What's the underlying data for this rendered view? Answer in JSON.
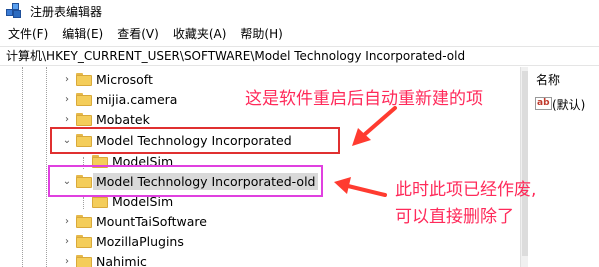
{
  "window": {
    "title": "注册表编辑器"
  },
  "menubar": {
    "items": [
      "文件(F)",
      "编辑(E)",
      "查看(V)",
      "收藏夹(A)",
      "帮助(H)"
    ]
  },
  "address": {
    "path": "计算机\\HKEY_CURRENT_USER\\SOFTWARE\\Model Technology Incorporated-old"
  },
  "tree": {
    "items": [
      {
        "label": "Microsoft",
        "expander": "›"
      },
      {
        "label": "mijia.camera",
        "expander": "›"
      },
      {
        "label": "Mobatek",
        "expander": "›"
      },
      {
        "label": "Model Technology Incorporated",
        "expander": "⌄"
      },
      {
        "label": "ModelSim",
        "expander": ""
      },
      {
        "label": "Model Technology Incorporated-old",
        "expander": "⌄"
      },
      {
        "label": "ModelSim",
        "expander": ""
      },
      {
        "label": "MountTaiSoftware",
        "expander": "›"
      },
      {
        "label": "MozillaPlugins",
        "expander": "›"
      },
      {
        "label": "Nahimic",
        "expander": "›"
      }
    ]
  },
  "rightpane": {
    "column_name": "名称",
    "value_icon": "ab",
    "value_name": "(默认)"
  },
  "annotations": {
    "note1": "这是软件重启后自动重新建的项",
    "note2_line1": "此时此项已经作废,",
    "note2_line2": "可以直接删除了"
  },
  "colors": {
    "red_box": "#e03030",
    "magenta_box": "#e040e0",
    "annotation_text": "#ff2a5a",
    "arrow": "#ff3b30"
  }
}
